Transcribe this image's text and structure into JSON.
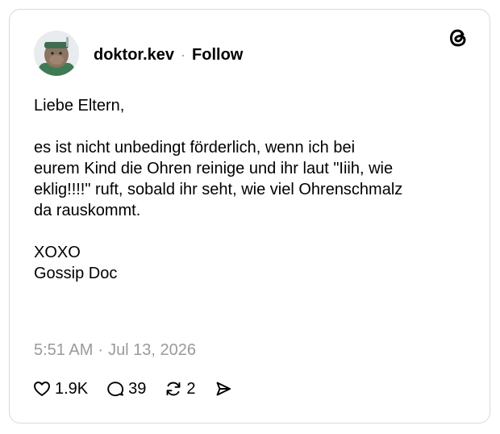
{
  "post": {
    "author": {
      "username": "doktor.kev",
      "separator": "·",
      "follow_label": "Follow"
    },
    "body": {
      "greeting": "Liebe Eltern,",
      "paragraph_lines": [
        "es ist nicht unbedingt förderlich, wenn ich bei",
        "eurem Kind die Ohren reinige und ihr laut \"Iiih, wie",
        "eklig!!!!\" ruft, sobald ihr seht, wie viel Ohrenschmalz",
        "da rauskommt."
      ],
      "signoff": "XOXO",
      "signature": "Gossip Doc"
    },
    "timestamp": {
      "time": "5:51 AM",
      "separator": "·",
      "date": "Jul 13, 2026"
    },
    "stats": {
      "likes": "1.9K",
      "replies": "39",
      "reposts": "2"
    },
    "icons": {
      "brand": "threads-logo-icon",
      "like": "heart-icon",
      "reply": "comment-bubble-icon",
      "repost": "repost-icon",
      "share": "send-icon"
    }
  }
}
